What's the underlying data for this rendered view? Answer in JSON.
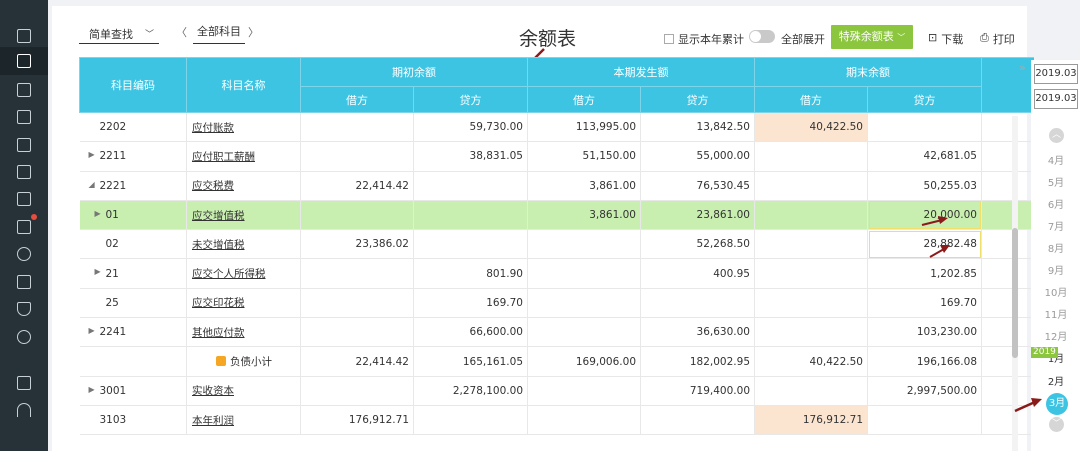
{
  "toolbar": {
    "simple_search": "简单查找",
    "all_subjects": "全部科目",
    "page_title": "余额表",
    "show_year_cumulative": "显示本年累计",
    "expand_all": "全部展开",
    "special_balance": "特殊余额表",
    "download": "下载",
    "print": "打印"
  },
  "table": {
    "headers": {
      "code": "科目编码",
      "name": "科目名称",
      "opening": "期初余额",
      "current": "本期发生额",
      "closing": "期末余额",
      "debit": "借方",
      "credit": "贷方"
    },
    "rows": [
      {
        "code": "2202",
        "name": "应付账款",
        "od": "",
        "oc": "59,730.00",
        "cd": "113,995.00",
        "cc": "13,842.50",
        "ed": "40,422.50",
        "ec": "",
        "caret": "",
        "sub": false
      },
      {
        "code": "2211",
        "name": "应付职工薪酬",
        "od": "",
        "oc": "38,831.05",
        "cd": "51,150.00",
        "cc": "55,000.00",
        "ed": "",
        "ec": "42,681.05",
        "caret": "▶",
        "sub": false
      },
      {
        "code": "2221",
        "name": "应交税费",
        "od": "22,414.42",
        "oc": "",
        "cd": "3,861.00",
        "cc": "76,530.45",
        "ed": "",
        "ec": "50,255.03",
        "caret": "◢",
        "sub": false
      },
      {
        "code": "01",
        "name": "应交增值税",
        "od": "",
        "oc": "",
        "cd": "3,861.00",
        "cc": "23,861.00",
        "ed": "",
        "ec": "20,000.00",
        "caret": "▶",
        "sub": true
      },
      {
        "code": "02",
        "name": "未交增值税",
        "od": "23,386.02",
        "oc": "",
        "cd": "",
        "cc": "52,268.50",
        "ed": "",
        "ec": "28,882.48",
        "caret": "",
        "sub": true
      },
      {
        "code": "21",
        "name": "应交个人所得税",
        "od": "",
        "oc": "801.90",
        "cd": "",
        "cc": "400.95",
        "ed": "",
        "ec": "1,202.85",
        "caret": "▶",
        "sub": true
      },
      {
        "code": "25",
        "name": "应交印花税",
        "od": "",
        "oc": "169.70",
        "cd": "",
        "cc": "",
        "ed": "",
        "ec": "169.70",
        "caret": "",
        "sub": true
      },
      {
        "code": "2241",
        "name": "其他应付款",
        "od": "",
        "oc": "66,600.00",
        "cd": "",
        "cc": "36,630.00",
        "ed": "",
        "ec": "103,230.00",
        "caret": "▶",
        "sub": false
      },
      {
        "code": "",
        "name": "负债小计",
        "od": "22,414.42",
        "oc": "165,161.05",
        "cd": "169,006.00",
        "cc": "182,002.95",
        "ed": "40,422.50",
        "ec": "196,166.08",
        "caret": "",
        "sub": false
      },
      {
        "code": "3001",
        "name": "实收资本",
        "od": "",
        "oc": "2,278,100.00",
        "cd": "",
        "cc": "719,400.00",
        "ed": "",
        "ec": "2,997,500.00",
        "caret": "▶",
        "sub": false
      },
      {
        "code": "3103",
        "name": "本年利润",
        "od": "176,912.71",
        "oc": "",
        "cd": "",
        "cc": "",
        "ed": "176,912.71",
        "ec": "",
        "caret": "",
        "sub": false
      }
    ]
  },
  "period": {
    "start": "2019.03",
    "end": "2019.03",
    "year_tag": "2019",
    "months": [
      "4月",
      "5月",
      "6月",
      "7月",
      "8月",
      "9月",
      "10月",
      "11月",
      "12月",
      "1月",
      "2月"
    ],
    "active_month": "3月"
  },
  "colors": {
    "header": "#3dc4e3",
    "highlight_row": "#c8eeb0",
    "peach_cell": "#fbe5d0",
    "accent_green": "#8cc63f",
    "sidebar": "#263238",
    "annotation_arrow": "#8b1a1a"
  }
}
